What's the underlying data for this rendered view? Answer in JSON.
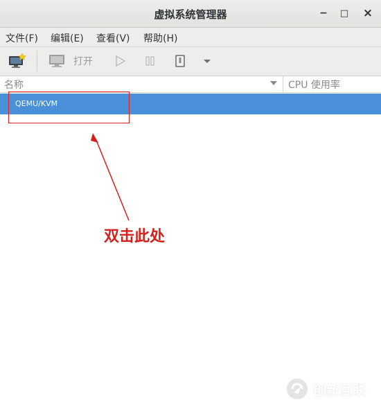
{
  "window": {
    "title": "虚拟系统管理器",
    "minimize": "−",
    "maximize": "□",
    "close": "×"
  },
  "menu": {
    "items": [
      "文件(F)",
      "编辑(E)",
      "查看(V)",
      "帮助(H)"
    ]
  },
  "toolbar": {
    "open_label": "打开"
  },
  "list": {
    "columns": [
      "名称",
      "CPU 使用率"
    ],
    "rows": [
      {
        "name": "QEMU/KVM",
        "selected": true
      }
    ]
  },
  "annotation": {
    "text": "双击此处",
    "color": "#d4201c"
  },
  "watermark": {
    "text": "创新互联"
  },
  "colors": {
    "selection": "#4a90d9",
    "highlight_border": "#e0211c"
  }
}
